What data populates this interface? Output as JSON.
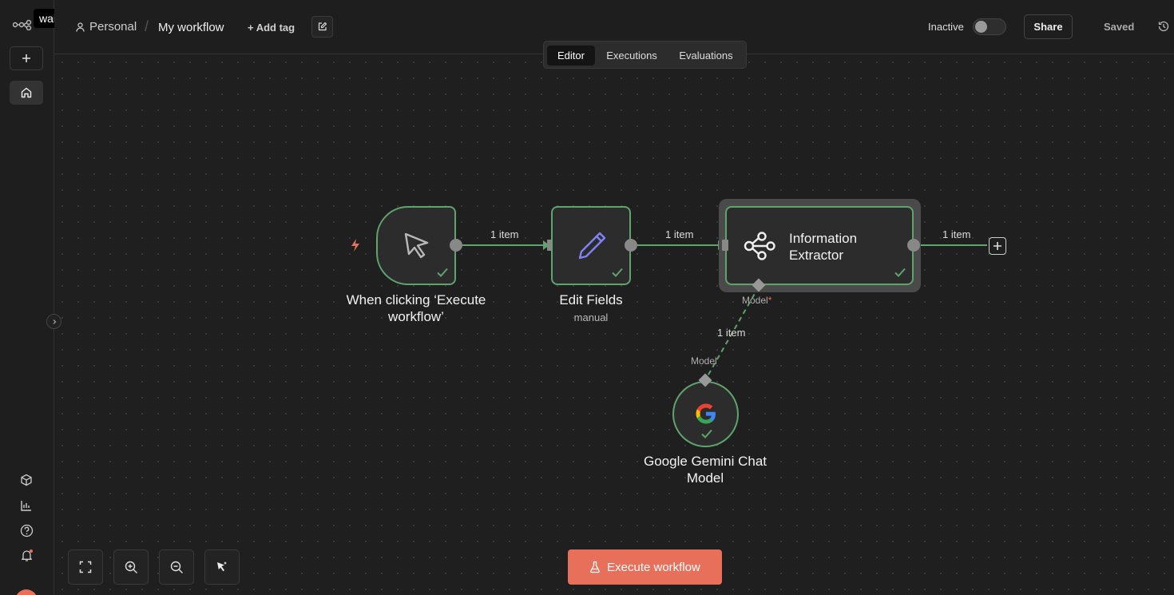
{
  "app": {
    "tooltip": "wait",
    "logo_icon": "n8n-logo-icon"
  },
  "header": {
    "project": "Personal",
    "separator": "/",
    "workflow_name": "My workflow",
    "add_tag": "+ Add tag",
    "status_label": "Inactive",
    "active": false,
    "share_label": "Share",
    "saved_label": "Saved"
  },
  "tabs": [
    {
      "label": "Editor",
      "active": true
    },
    {
      "label": "Executions",
      "active": false
    },
    {
      "label": "Evaluations",
      "active": false
    }
  ],
  "nodes": {
    "trigger": {
      "label_line1": "When clicking ‘Execute",
      "label_line2": "workflow’"
    },
    "edit_fields": {
      "label": "Edit Fields",
      "sublabel": "manual"
    },
    "extractor": {
      "label_line1": "Information",
      "label_line2": "Extractor",
      "port_label": "Model",
      "port_required_mark": "*"
    },
    "gemini": {
      "label_line1": "Google Gemini Chat",
      "label_line2": "Model",
      "port_label": "Model"
    }
  },
  "edges": {
    "e1": "1 item",
    "e2": "1 item",
    "e3": "1 item",
    "e4": "1 item"
  },
  "colors": {
    "accent": "#e8705b",
    "success": "#5fa36d",
    "canvas": "#1f1f1f",
    "edit_icon": "#7f83f5"
  },
  "footer": {
    "execute_label": "Execute workflow"
  }
}
